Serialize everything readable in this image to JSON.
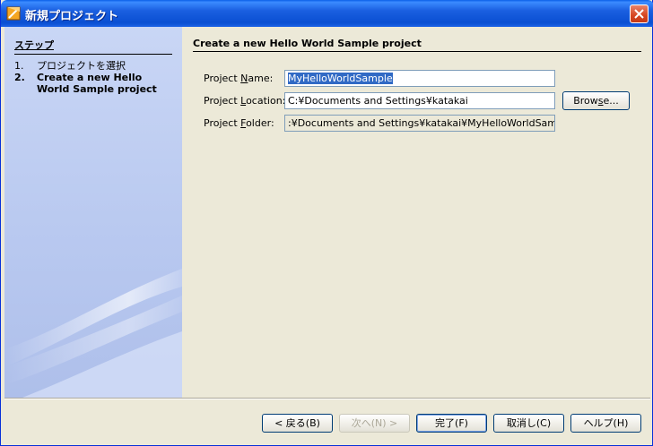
{
  "window": {
    "title": "新規プロジェクト",
    "icon": "netbeans-cube-icon"
  },
  "steps": {
    "heading": "ステップ",
    "items": [
      {
        "num": "1.",
        "label": "プロジェクトを選択",
        "active": false
      },
      {
        "num": "2.",
        "label": "Create a new Hello World Sample project",
        "active": true
      }
    ]
  },
  "main": {
    "heading": "Create a new Hello World Sample project",
    "fields": {
      "name": {
        "label_pre": "Project ",
        "label_mn": "N",
        "label_post": "ame:",
        "value": "MyHelloWorldSample"
      },
      "location": {
        "label_pre": "Project ",
        "label_mn": "L",
        "label_post": "ocation:",
        "value": "C:¥Documents and Settings¥katakai"
      },
      "folder": {
        "label_pre": "Project ",
        "label_mn": "F",
        "label_post": "older:",
        "value": ":¥Documents and Settings¥katakai¥MyHelloWorldSample"
      }
    },
    "browse_pre": "Brow",
    "browse_mn": "s",
    "browse_post": "e..."
  },
  "footer": {
    "back": "< 戻る(B)",
    "next": "次へ(N) >",
    "finish": "完了(F)",
    "cancel": "取消し(C)",
    "help": "ヘルプ(H)"
  },
  "colors": {
    "titlebar": "#0a4fd2",
    "sidebar": "#c9d6f5",
    "selection": "#316ac5"
  }
}
